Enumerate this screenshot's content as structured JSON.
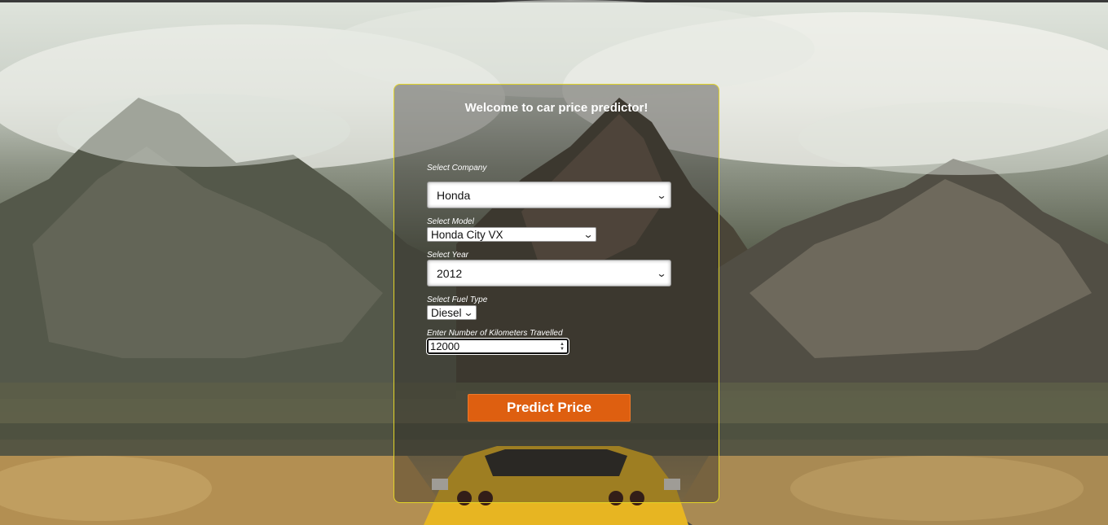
{
  "header": {
    "title": "Welcome to car price predictor!"
  },
  "form": {
    "company": {
      "label": "Select Company",
      "value": "Honda"
    },
    "model": {
      "label": "Select Model",
      "value": "Honda City VX"
    },
    "year": {
      "label": "Select Year",
      "value": "2012"
    },
    "fuel": {
      "label": "Select Fuel Type",
      "value": "Diesel"
    },
    "kms": {
      "label": "Enter Number of Kilometers Travelled",
      "value": "12000"
    },
    "submit_label": "Predict Price"
  },
  "colors": {
    "card_border": "#e2d428",
    "button": "#de5f10",
    "car": "#e7b522"
  },
  "icons": [
    "chevron-down-icon",
    "spinner-arrows-icon"
  ]
}
